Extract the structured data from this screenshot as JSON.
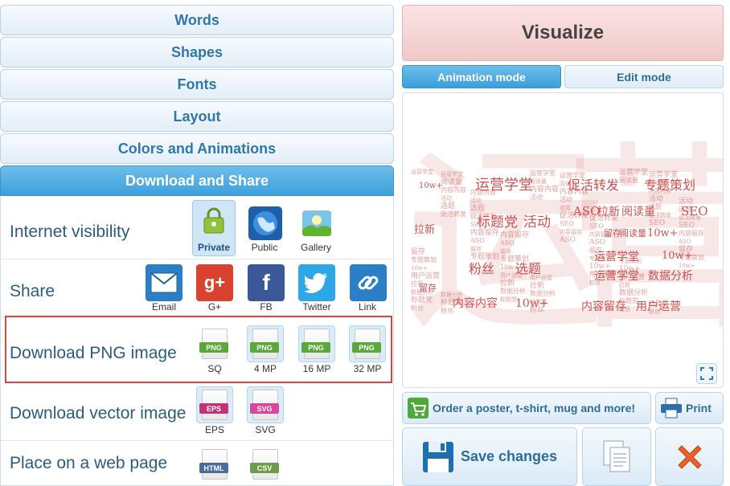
{
  "accordion": {
    "words": "Words",
    "shapes": "Shapes",
    "fonts": "Fonts",
    "layout": "Layout",
    "colors": "Colors and Animations",
    "download_share": "Download and Share"
  },
  "visibility": {
    "label": "Internet visibility",
    "options": [
      "Private",
      "Public",
      "Gallery"
    ],
    "selected": "Private"
  },
  "share": {
    "label": "Share",
    "items": [
      "Email",
      "G+",
      "FB",
      "Twitter",
      "Link"
    ]
  },
  "png": {
    "label": "Download PNG image",
    "badge": "PNG",
    "sizes": [
      "SQ",
      "4 MP",
      "16 MP",
      "32 MP"
    ]
  },
  "vector": {
    "label": "Download vector image",
    "items": [
      "EPS",
      "SVG"
    ]
  },
  "webpage": {
    "label": "Place on a web page",
    "badges": [
      "HTML",
      "CSV"
    ]
  },
  "right": {
    "visualize": "Visualize",
    "animation_mode": "Animation mode",
    "edit_mode": "Edit mode",
    "order": "Order a poster, t-shirt, mug and more!",
    "print": "Print",
    "save": "Save changes"
  },
  "wordcloud": {
    "phrases": [
      "运营学堂",
      "促活转发",
      "专题策划",
      "标题党",
      "活动",
      "ASO",
      "拉新",
      "阅读量",
      "SEO",
      "10w+",
      "粉丝",
      "选题",
      "留存",
      "数据分析",
      "内容内容",
      "内容留存",
      "用户运营"
    ]
  },
  "colors": {
    "accent": "#3ca0dc",
    "visualize_bg": "#f1c8c8",
    "highlight_border": "#d9443b",
    "png_band": "#5aa83a",
    "eps_band": "#c2347a",
    "svg_band": "#d8489a",
    "wordcloud_text": "#d05050"
  }
}
